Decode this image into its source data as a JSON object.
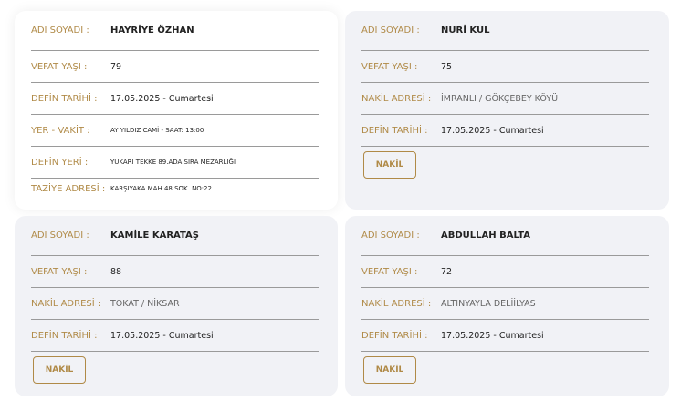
{
  "cards": [
    {
      "rows": [
        {
          "label": "ADI SOYADI :",
          "value": "HAYRİYE ÖZHAN"
        },
        {
          "label": "VEFAT YAŞI :",
          "value": "79"
        },
        {
          "label": "DEFİN TARİHİ :",
          "value": "17.05.2025 - Cumartesi"
        },
        {
          "label": "YER - VAKİT :",
          "value": "AY YILDIZ CAMİ - SAAT: 13:00"
        },
        {
          "label": "DEFİN YERİ :",
          "value": "YUKARI TEKKE 89.ADA SIRA MEZARLIĞI"
        },
        {
          "label": "TAZİYE ADRESİ :",
          "value": "KARŞIYAKA MAH 48.SOK. NO:22"
        }
      ]
    },
    {
      "rows": [
        {
          "label": "ADI SOYADI :",
          "value": "NURİ KUL"
        },
        {
          "label": "VEFAT YAŞI :",
          "value": "75"
        },
        {
          "label": "NAKİL ADRESİ :",
          "value": "İMRANLI / GÖKÇEBEY KÖYÜ"
        },
        {
          "label": "DEFİN TARİHİ :",
          "value": "17.05.2025 - Cumartesi"
        }
      ],
      "button": "NAKİL"
    },
    {
      "rows": [
        {
          "label": "ADI SOYADI :",
          "value": "KAMİLE KARATAŞ"
        },
        {
          "label": "VEFAT YAŞI :",
          "value": "88"
        },
        {
          "label": "NAKİL ADRESİ :",
          "value": "TOKAT / NİKSAR"
        },
        {
          "label": "DEFİN TARİHİ :",
          "value": "17.05.2025 - Cumartesi"
        }
      ],
      "button": "NAKİL"
    },
    {
      "rows": [
        {
          "label": "ADI SOYADI :",
          "value": "ABDULLAH BALTA"
        },
        {
          "label": "VEFAT YAŞI :",
          "value": "72"
        },
        {
          "label": "NAKİL ADRESİ :",
          "value": "ALTINYAYLA DELİİLYAS"
        },
        {
          "label": "DEFİN TARİHİ :",
          "value": "17.05.2025 - Cumartesi"
        }
      ],
      "button": "NAKİL"
    }
  ],
  "colors": {
    "label": "#b08a47",
    "text": "#222222",
    "card_gray": "#f1f2f6"
  }
}
